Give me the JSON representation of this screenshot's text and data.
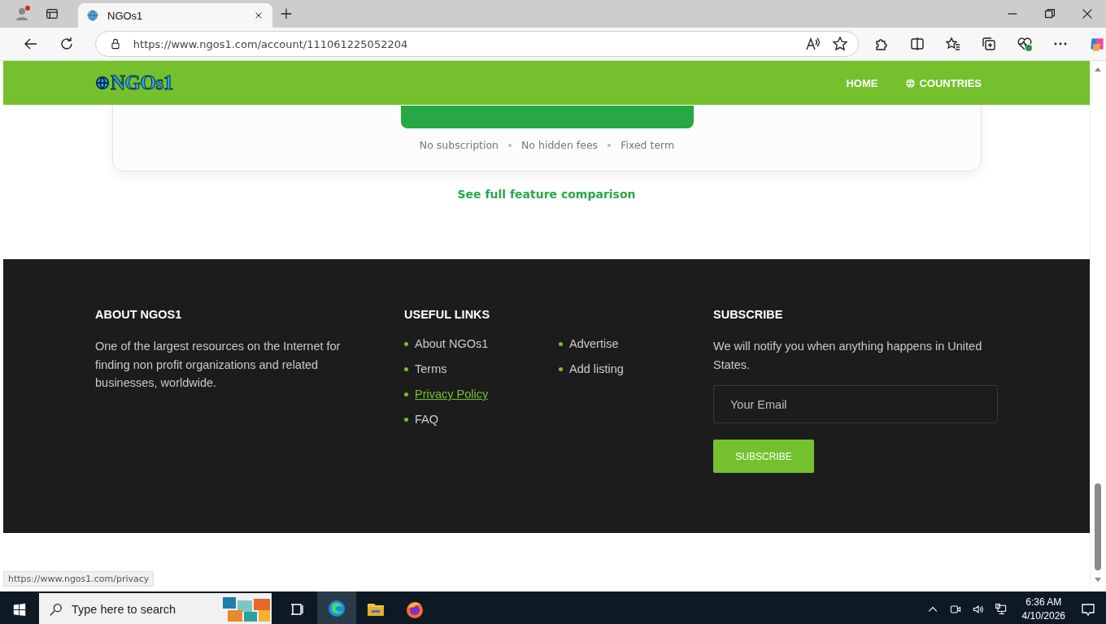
{
  "browser": {
    "tabs": [
      {
        "title": "NGOs1",
        "selected": true
      }
    ],
    "url": "https://www.ngos1.com/account/111061225052204"
  },
  "site_header": {
    "logo": "NGOs1",
    "nav": [
      {
        "label": "HOME",
        "kind": "plain"
      },
      {
        "label": "COUNTRIES",
        "kind": "globe"
      }
    ]
  },
  "pricing_card": {
    "notes": [
      "No subscription",
      "No hidden fees",
      "Fixed term"
    ]
  },
  "comparison_link": "See full feature comparison",
  "footer": {
    "about": {
      "title": "ABOUT NGOS1",
      "text": "One of the largest resources on the Internet for finding non profit organizations and related businesses, worldwide."
    },
    "links": {
      "title": "USEFUL LINKS",
      "columns": [
        [
          {
            "label": "About NGOs1",
            "hovered": false
          },
          {
            "label": "Terms",
            "hovered": false
          },
          {
            "label": "Privacy Policy",
            "hovered": true
          },
          {
            "label": "FAQ",
            "hovered": false
          }
        ],
        [
          {
            "label": "Advertise",
            "hovered": false
          },
          {
            "label": "Add listing",
            "hovered": false
          }
        ]
      ]
    },
    "subscribe": {
      "title": "SUBSCRIBE",
      "text": "We will notify you when anything happens in United States.",
      "placeholder": "Your Email",
      "button": "SUBSCRIBE"
    }
  },
  "status_url": "https://www.ngos1.com/privacy",
  "taskbar": {
    "search_placeholder": "Type here to search",
    "apps": [
      {
        "kind": "taskview",
        "active": false
      },
      {
        "kind": "edge",
        "active": true
      },
      {
        "kind": "folder",
        "active": false
      },
      {
        "kind": "firefox",
        "active": false
      }
    ],
    "time": "6:36 AM",
    "date": "4/10/2026"
  }
}
